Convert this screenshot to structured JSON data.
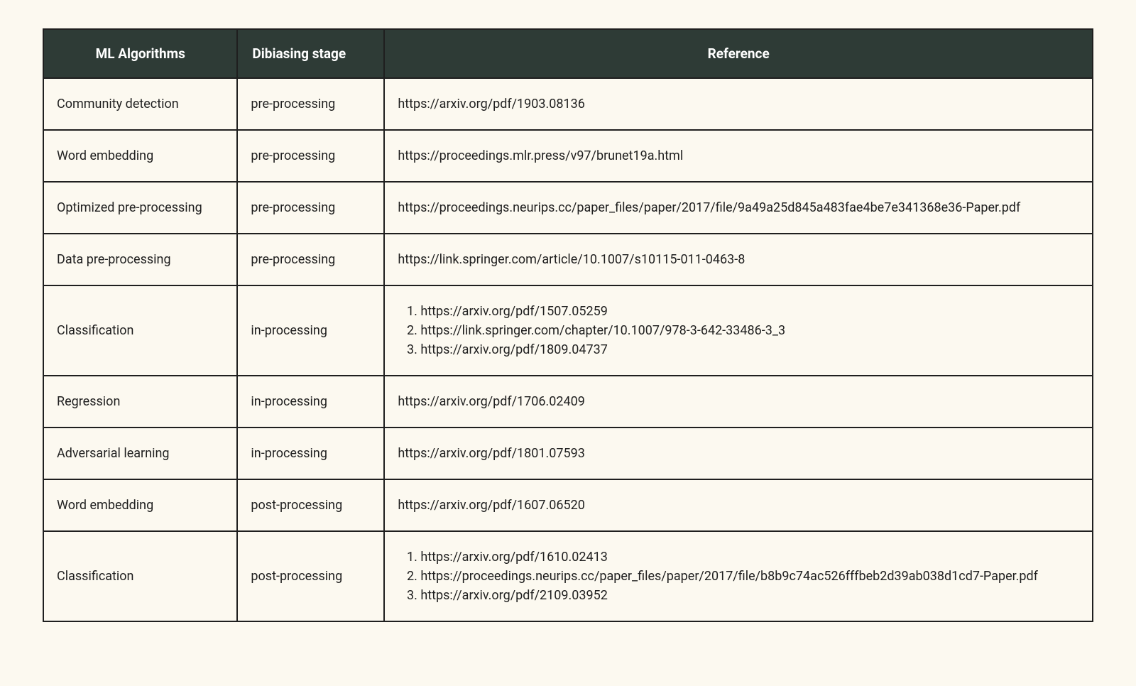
{
  "table": {
    "headers": {
      "algo": "ML Algorithms",
      "stage": "Dibiasing stage",
      "ref": "Reference"
    },
    "rows": [
      {
        "algo": "Community detection",
        "stage": "pre-processing",
        "refs": [
          "https://arxiv.org/pdf/1903.08136"
        ]
      },
      {
        "algo": "Word embedding",
        "stage": "pre-processing",
        "refs": [
          "https://proceedings.mlr.press/v97/brunet19a.html"
        ]
      },
      {
        "algo": "Optimized pre-processing",
        "stage": "pre-processing",
        "refs": [
          "https://proceedings.neurips.cc/paper_files/paper/2017/file/9a49a25d845a483fae4be7e341368e36-Paper.pdf"
        ]
      },
      {
        "algo": "Data pre-processing",
        "stage": "pre-processing",
        "refs": [
          "https://link.springer.com/article/10.1007/s10115-011-0463-8"
        ]
      },
      {
        "algo": "Classification",
        "stage": "in-processing",
        "refs": [
          "https://arxiv.org/pdf/1507.05259",
          "https://link.springer.com/chapter/10.1007/978-3-642-33486-3_3",
          "https://arxiv.org/pdf/1809.04737"
        ]
      },
      {
        "algo": "Regression",
        "stage": "in-processing",
        "refs": [
          "https://arxiv.org/pdf/1706.02409"
        ]
      },
      {
        "algo": "Adversarial learning",
        "stage": "in-processing",
        "refs": [
          "https://arxiv.org/pdf/1801.07593"
        ]
      },
      {
        "algo": "Word embedding",
        "stage": "post-processing",
        "refs": [
          "https://arxiv.org/pdf/1607.06520"
        ]
      },
      {
        "algo": "Classification",
        "stage": "post-processing",
        "refs": [
          "https://arxiv.org/pdf/1610.02413",
          "https://proceedings.neurips.cc/paper_files/paper/2017/file/b8b9c74ac526fffbeb2d39ab038d1cd7-Paper.pdf",
          "https://arxiv.org/pdf/2109.03952"
        ]
      }
    ]
  }
}
